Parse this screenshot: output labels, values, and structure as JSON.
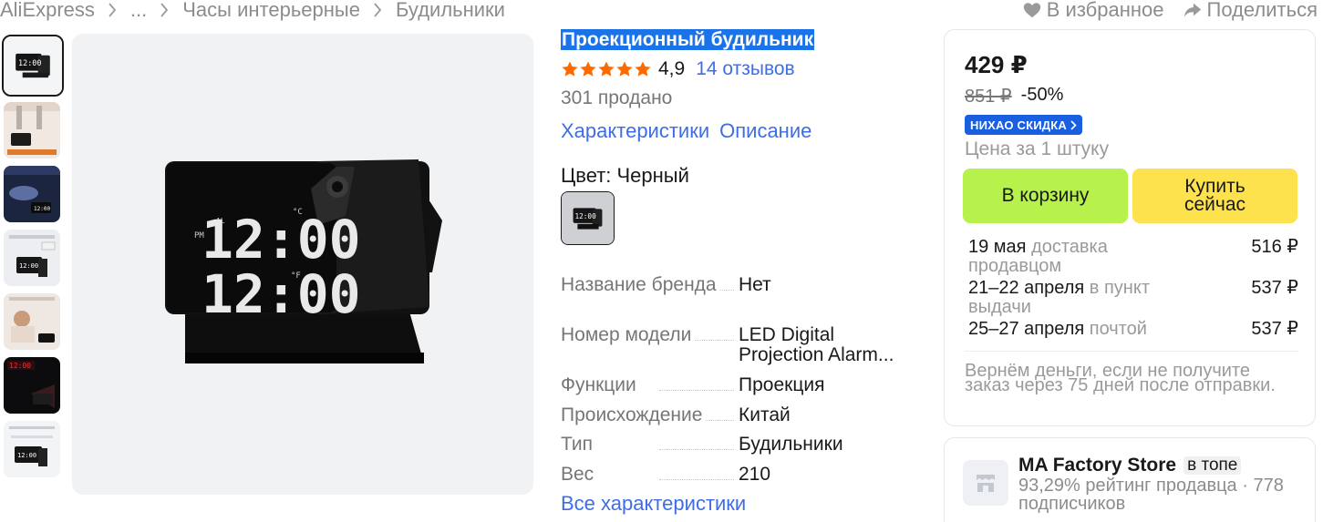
{
  "breadcrumb": [
    "AliExpress",
    "...",
    "Часы интерьерные",
    "Будильники"
  ],
  "top_actions": {
    "favorite": "В избранное",
    "share": "Поделиться"
  },
  "product": {
    "title": "Проекционный будильник",
    "rating": "4,9",
    "stars": 5,
    "reviews": "14 отзывов",
    "sold": "301 продано",
    "links": {
      "characteristics": "Характеристики",
      "description": "Описание"
    },
    "color_label": "Цвет: Черный",
    "clock_time": "12:00",
    "specs": [
      {
        "key": "Название бренда",
        "value": "Нет"
      },
      {
        "key": "Номер модели",
        "value": "LED Digital Projection Alarm..."
      },
      {
        "key": "Функции",
        "value": "Проекция"
      },
      {
        "key": "Происхождение",
        "value": "Китай"
      },
      {
        "key": "Тип",
        "value": "Будильники"
      },
      {
        "key": "Вес",
        "value": "210"
      }
    ],
    "all_specs": "Все характеристики"
  },
  "buybox": {
    "price": "429 ₽",
    "old_price": "851 ₽",
    "discount": "-50%",
    "badge": "НИХАО СКИДКА",
    "unit": "Цена за 1 штуку",
    "cart_button": "В корзину",
    "buy_button": "Купить сейчас",
    "delivery": [
      {
        "date": "19 мая",
        "method": "доставка продавцом",
        "price": "516 ₽"
      },
      {
        "date": "21–22 апреля",
        "method": "в пункт выдачи",
        "price": "537 ₽"
      },
      {
        "date": "25–27 апреля",
        "method": "почтой",
        "price": "537 ₽"
      }
    ],
    "refund": "Вернём деньги, если не получите заказ через 75 дней после отправки."
  },
  "store": {
    "name": "MA Factory Store",
    "badge": "в топе",
    "meta": "93,29% рейтинг продавца · 778 подписчиков"
  },
  "colors": {
    "link": "#3e6de6",
    "cart": "#b7f14b",
    "buy": "#fde24d",
    "star": "#ff6a00",
    "badge": "#1a5fe0",
    "title_highlight": "#1a73e8"
  }
}
